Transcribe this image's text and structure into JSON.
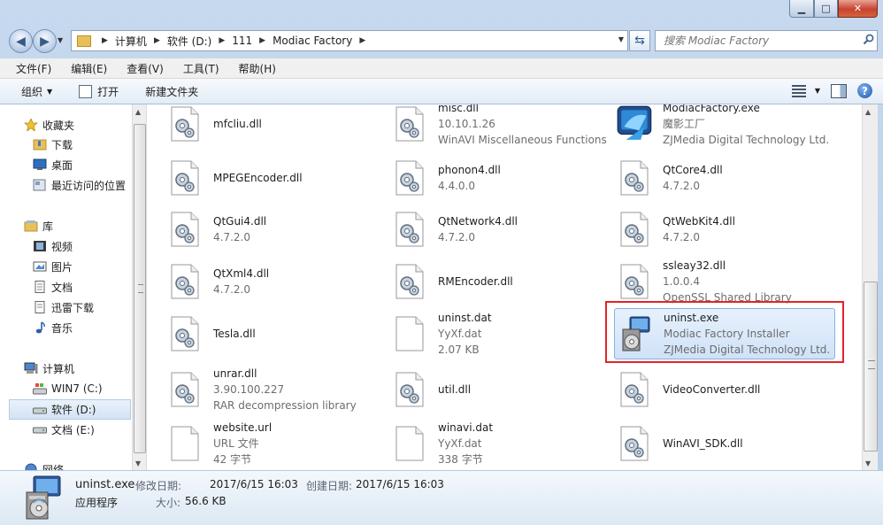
{
  "window": {
    "min_glyph": "▁",
    "max_glyph": "□",
    "close_glyph": "✕"
  },
  "address": {
    "crumbs": [
      "计算机",
      "软件 (D:)",
      "111",
      "Modiac Factory"
    ],
    "search_placeholder": "搜索 Modiac Factory"
  },
  "menu": [
    "文件(F)",
    "编辑(E)",
    "查看(V)",
    "工具(T)",
    "帮助(H)"
  ],
  "toolbar": {
    "organize": "组织",
    "open": "打开",
    "new_folder": "新建文件夹",
    "help": "?"
  },
  "nav": {
    "favorites": "收藏夹",
    "downloads": "下载",
    "desktop": "桌面",
    "recent": "最近访问的位置",
    "library": "库",
    "videos": "视频",
    "pictures": "图片",
    "documents": "文档",
    "xunlei": "迅雷下载",
    "music": "音乐",
    "computer": "计算机",
    "drive_c": "WIN7 (C:)",
    "drive_d": "软件 (D:)",
    "drive_e": "文档 (E:)",
    "network": "网络"
  },
  "files": [
    {
      "name": "mfcliu.dll",
      "meta": [],
      "icon": "dll-gear-icon"
    },
    {
      "name": "misc.dll",
      "meta": [
        "10.10.1.26",
        "WinAVI Miscellaneous Functions"
      ],
      "icon": "dll-gear-icon"
    },
    {
      "name": "ModiacFactory.exe",
      "meta": [
        "魔影工厂",
        "ZJMedia Digital Technology Ltd."
      ],
      "icon": "app-icon"
    },
    {
      "name": "MPEGEncoder.dll",
      "meta": [],
      "icon": "dll-gear-icon"
    },
    {
      "name": "phonon4.dll",
      "meta": [
        "4.4.0.0"
      ],
      "icon": "dll-gear-icon"
    },
    {
      "name": "QtCore4.dll",
      "meta": [
        "4.7.2.0"
      ],
      "icon": "dll-gear-icon"
    },
    {
      "name": "QtGui4.dll",
      "meta": [
        "4.7.2.0"
      ],
      "icon": "dll-gear-icon"
    },
    {
      "name": "QtNetwork4.dll",
      "meta": [
        "4.7.2.0"
      ],
      "icon": "dll-gear-icon"
    },
    {
      "name": "QtWebKit4.dll",
      "meta": [
        "4.7.2.0"
      ],
      "icon": "dll-gear-icon"
    },
    {
      "name": "QtXml4.dll",
      "meta": [
        "4.7.2.0"
      ],
      "icon": "dll-gear-icon"
    },
    {
      "name": "RMEncoder.dll",
      "meta": [],
      "icon": "dll-gear-icon"
    },
    {
      "name": "ssleay32.dll",
      "meta": [
        "1.0.0.4",
        "OpenSSL Shared Library"
      ],
      "icon": "dll-gear-icon"
    },
    {
      "name": "Tesla.dll",
      "meta": [],
      "icon": "dll-gear-icon"
    },
    {
      "name": "uninst.dat",
      "meta": [
        "YyXf.dat",
        "2.07 KB"
      ],
      "icon": "blank-file-icon"
    },
    {
      "name": "uninst.exe",
      "meta": [
        "Modiac Factory Installer",
        "ZJMedia Digital Technology Ltd."
      ],
      "icon": "installer-icon",
      "selected": true
    },
    {
      "name": "unrar.dll",
      "meta": [
        "3.90.100.227",
        "RAR decompression library"
      ],
      "icon": "dll-gear-icon"
    },
    {
      "name": "util.dll",
      "meta": [],
      "icon": "dll-gear-icon"
    },
    {
      "name": "VideoConverter.dll",
      "meta": [],
      "icon": "dll-gear-icon"
    },
    {
      "name": "website.url",
      "meta": [
        "URL 文件",
        "42 字节"
      ],
      "icon": "blank-file-icon"
    },
    {
      "name": "winavi.dat",
      "meta": [
        "YyXf.dat",
        "338 字节"
      ],
      "icon": "blank-file-icon"
    },
    {
      "name": "WinAVI_SDK.dll",
      "meta": [],
      "icon": "dll-gear-icon"
    }
  ],
  "details": {
    "name": "uninst.exe",
    "type": "应用程序",
    "modified_label": "修改日期:",
    "modified_value": "2017/6/15 16:03",
    "created_label": "创建日期:",
    "created_value": "2017/6/15 16:03",
    "size_label": "大小:",
    "size_value": "56.6 KB"
  },
  "colors": {
    "highlight_border": "#e0242b",
    "selection_fill": "#cfe2f8"
  }
}
